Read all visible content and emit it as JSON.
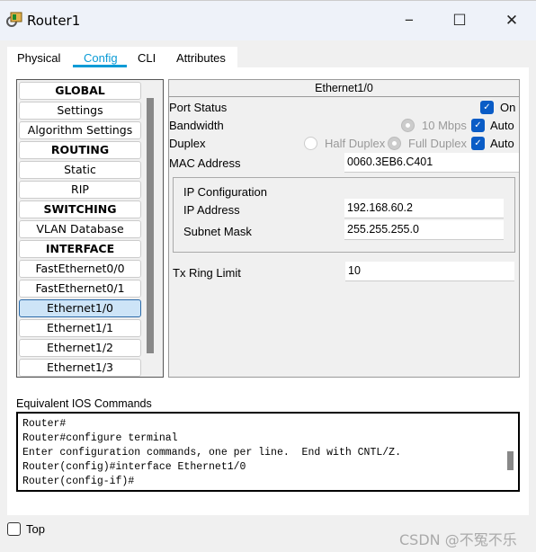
{
  "window": {
    "title": "Router1",
    "icon": "router-icon",
    "controls": {
      "minimize": "−",
      "maximize": "☐",
      "close": "✕"
    }
  },
  "tabs": [
    {
      "label": "Physical"
    },
    {
      "label": "Config",
      "active": true
    },
    {
      "label": "CLI"
    },
    {
      "label": "Attributes"
    }
  ],
  "accent": "#0a9bd6",
  "sidebar": {
    "items": [
      {
        "label": "GLOBAL",
        "header": true
      },
      {
        "label": "Settings"
      },
      {
        "label": "Algorithm Settings"
      },
      {
        "label": "ROUTING",
        "header": true
      },
      {
        "label": "Static"
      },
      {
        "label": "RIP"
      },
      {
        "label": "SWITCHING",
        "header": true
      },
      {
        "label": "VLAN Database"
      },
      {
        "label": "INTERFACE",
        "header": true
      },
      {
        "label": "FastEthernet0/0"
      },
      {
        "label": "FastEthernet0/1"
      },
      {
        "label": "Ethernet1/0",
        "selected": true
      },
      {
        "label": "Ethernet1/1"
      },
      {
        "label": "Ethernet1/2"
      },
      {
        "label": "Ethernet1/3"
      }
    ]
  },
  "panel": {
    "title": "Ethernet1/0",
    "port_status": {
      "label": "Port Status",
      "on_label": "On",
      "checked": true
    },
    "bandwidth": {
      "label": "Bandwidth",
      "option": "10 Mbps",
      "auto_label": "Auto",
      "auto_checked": true
    },
    "duplex": {
      "label": "Duplex",
      "half": "Half Duplex",
      "full": "Full Duplex",
      "auto_label": "Auto",
      "auto_checked": true
    },
    "mac": {
      "label": "MAC Address",
      "value": "0060.3EB6.C401"
    },
    "ip_config": {
      "title": "IP Configuration",
      "ip_label": "IP Address",
      "ip_value": "192.168.60.2",
      "mask_label": "Subnet Mask",
      "mask_value": "255.255.255.0"
    },
    "tx_ring": {
      "label": "Tx Ring Limit",
      "value": "10"
    }
  },
  "ios": {
    "label": "Equivalent IOS Commands",
    "lines": [
      "Router#",
      "Router#configure terminal",
      "Enter configuration commands, one per line.  End with CNTL/Z.",
      "Router(config)#interface Ethernet1/0",
      "Router(config-if)#"
    ]
  },
  "footer": {
    "top_label": "Top",
    "top_checked": false,
    "watermark": "CSDN @不冤不乐"
  }
}
